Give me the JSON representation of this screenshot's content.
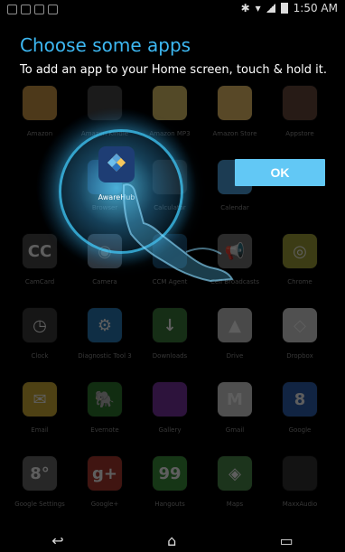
{
  "status_bar": {
    "time": "1:50 AM"
  },
  "header": {
    "title": "Choose some apps",
    "subtitle": "To add an app to your Home screen, touch & hold it."
  },
  "featured_app": {
    "label": "AwareHub"
  },
  "ok_button": {
    "label": "OK"
  },
  "apps": [
    {
      "row": 1,
      "col": 1,
      "label": "Amazon",
      "icon": "amazon-icon"
    },
    {
      "row": 1,
      "col": 2,
      "label": "Amazon Kindle",
      "icon": "kindle-icon"
    },
    {
      "row": 1,
      "col": 3,
      "label": "Amazon MP3",
      "icon": "mp3-icon"
    },
    {
      "row": 1,
      "col": 4,
      "label": "Amazon Store",
      "icon": "amazon-store-icon"
    },
    {
      "row": 1,
      "col": 5,
      "label": "Appstore",
      "icon": "appstore-icon"
    },
    {
      "row": 2,
      "col": 1,
      "label": "AwareHub",
      "icon": "awarehub-icon"
    },
    {
      "row": 2,
      "col": 2,
      "label": "Browser",
      "icon": "browser-icon"
    },
    {
      "row": 2,
      "col": 3,
      "label": "Calculator",
      "icon": "calculator-icon"
    },
    {
      "row": 2,
      "col": 4,
      "label": "Calendar",
      "icon": "calendar-icon"
    },
    {
      "row": 3,
      "col": 1,
      "label": "CamCard",
      "icon": "camcard-icon"
    },
    {
      "row": 3,
      "col": 2,
      "label": "Camera",
      "icon": "camera-icon"
    },
    {
      "row": 3,
      "col": 3,
      "label": "CCM Agent",
      "icon": "ccm-icon"
    },
    {
      "row": 3,
      "col": 4,
      "label": "Cell Broadcasts",
      "icon": "megaphone-icon"
    },
    {
      "row": 3,
      "col": 5,
      "label": "Chrome",
      "icon": "chrome-icon"
    },
    {
      "row": 4,
      "col": 1,
      "label": "Clock",
      "icon": "clock-icon"
    },
    {
      "row": 4,
      "col": 2,
      "label": "Diagnostic Tool 3",
      "icon": "diagnostic-icon"
    },
    {
      "row": 4,
      "col": 3,
      "label": "Downloads",
      "icon": "downloads-icon"
    },
    {
      "row": 4,
      "col": 4,
      "label": "Drive",
      "icon": "drive-icon"
    },
    {
      "row": 4,
      "col": 5,
      "label": "Dropbox",
      "icon": "dropbox-icon"
    },
    {
      "row": 5,
      "col": 1,
      "label": "Email",
      "icon": "email-icon"
    },
    {
      "row": 5,
      "col": 2,
      "label": "Evernote",
      "icon": "evernote-icon"
    },
    {
      "row": 5,
      "col": 3,
      "label": "Gallery",
      "icon": "gallery-icon"
    },
    {
      "row": 5,
      "col": 4,
      "label": "Gmail",
      "icon": "gmail-icon"
    },
    {
      "row": 5,
      "col": 5,
      "label": "Google",
      "icon": "google-icon"
    },
    {
      "row": 6,
      "col": 1,
      "label": "Google Settings",
      "icon": "google-settings-icon"
    },
    {
      "row": 6,
      "col": 2,
      "label": "Google+",
      "icon": "googleplus-icon"
    },
    {
      "row": 6,
      "col": 3,
      "label": "Hangouts",
      "icon": "hangouts-icon"
    },
    {
      "row": 6,
      "col": 4,
      "label": "Maps",
      "icon": "maps-icon"
    },
    {
      "row": 6,
      "col": 5,
      "label": "MaxxAudio",
      "icon": "maxxaudio-icon"
    }
  ],
  "colors": {
    "accent": "#3db8f2",
    "ok": "#62c8f5",
    "background": "#000000"
  },
  "nav_icons": [
    "back-icon",
    "home-icon",
    "recent-apps-icon"
  ]
}
